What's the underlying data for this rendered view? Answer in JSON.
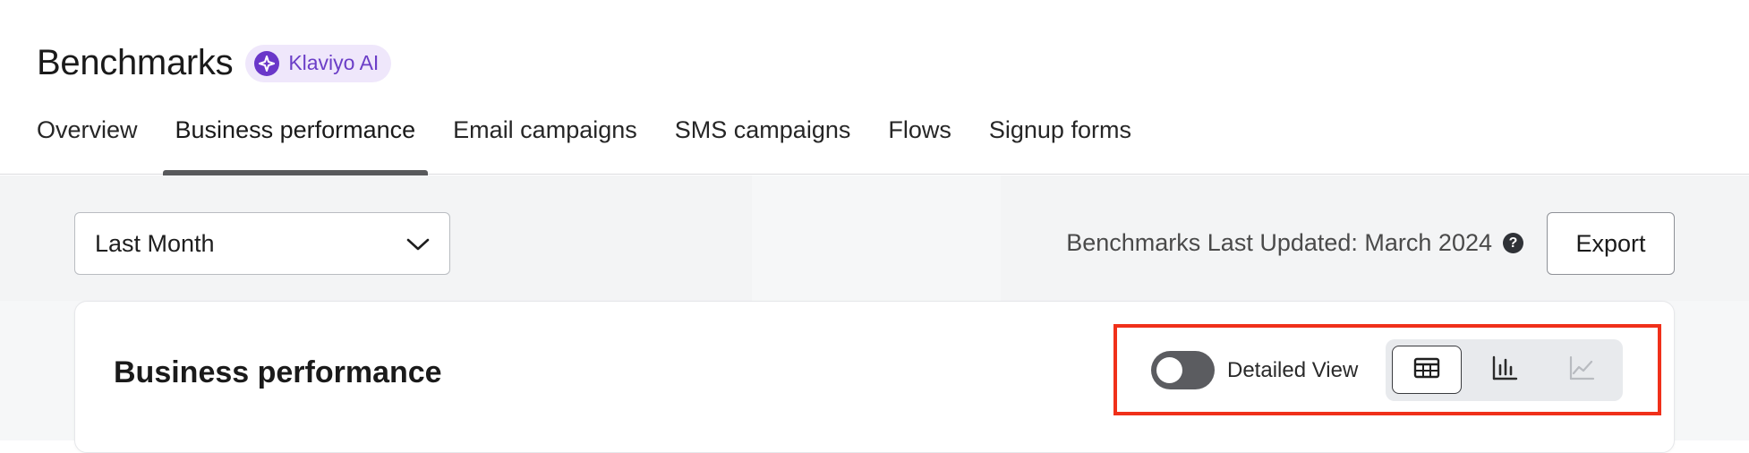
{
  "header": {
    "title": "Benchmarks",
    "badge_label": "Klaviyo AI",
    "badge_icon": "sparkle-icon"
  },
  "tabs": [
    {
      "label": "Overview",
      "active": false
    },
    {
      "label": "Business performance",
      "active": true
    },
    {
      "label": "Email campaigns",
      "active": false
    },
    {
      "label": "SMS campaigns",
      "active": false
    },
    {
      "label": "Flows",
      "active": false
    },
    {
      "label": "Signup forms",
      "active": false
    }
  ],
  "filters": {
    "date_range_selected": "Last Month",
    "updated_text": "Benchmarks Last Updated: March 2024",
    "help_glyph": "?",
    "export_label": "Export"
  },
  "card": {
    "title": "Business performance",
    "detailed_view_label": "Detailed View",
    "detailed_view_on": false,
    "view_modes": [
      "table",
      "bar-chart",
      "line-chart"
    ],
    "selected_view": "table"
  },
  "colors": {
    "accent_purple": "#6a37c9",
    "badge_bg": "#efe7fb",
    "highlight_red": "#f0301a",
    "toggle_bg": "#5b5c60"
  }
}
